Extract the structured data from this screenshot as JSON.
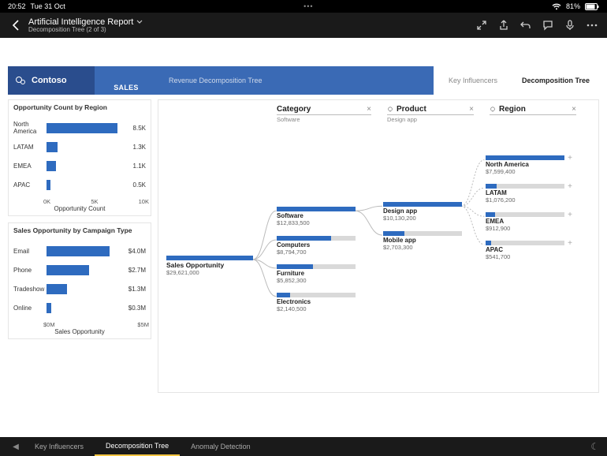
{
  "ios": {
    "time": "20:52",
    "date": "Tue 31 Oct",
    "battery": "81%"
  },
  "header": {
    "title": "Artificial Intelligence Report",
    "subtitle": "Decomposition Tree (2 of 3)"
  },
  "ribbon": {
    "brand": "Contoso",
    "sales": "SALES",
    "rev": "Revenue Decomposition Tree",
    "key": "Key Influencers",
    "decomp": "Decomposition Tree"
  },
  "mini_region": {
    "title": "Opportunity Count by Region",
    "axis_label": "Opportunity Count",
    "ticks": [
      "0K",
      "5K",
      "10K"
    ]
  },
  "mini_campaign": {
    "title": "Sales Opportunity by Campaign Type",
    "axis_label": "Sales Opportunity",
    "ticks": [
      "$0M",
      "$5M"
    ]
  },
  "tree_headers": {
    "category": {
      "title": "Category",
      "sub": "Software"
    },
    "product": {
      "title": "Product",
      "sub": "Design app"
    },
    "region": {
      "title": "Region",
      "sub": ""
    }
  },
  "tree": {
    "root": {
      "title": "Sales Opportunity",
      "value": "$29,621,000"
    },
    "software": {
      "title": "Software",
      "value": "$12,833,500"
    },
    "computers": {
      "title": "Computers",
      "value": "$8,794,700"
    },
    "furniture": {
      "title": "Furniture",
      "value": "$5,852,300"
    },
    "electronics": {
      "title": "Electronics",
      "value": "$2,140,500"
    },
    "design": {
      "title": "Design app",
      "value": "$10,130,200"
    },
    "mobile": {
      "title": "Mobile app",
      "value": "$2,703,300"
    },
    "na": {
      "title": "North America",
      "value": "$7,599,400"
    },
    "latam": {
      "title": "LATAM",
      "value": "$1,076,200"
    },
    "emea": {
      "title": "EMEA",
      "value": "$912,900"
    },
    "apac": {
      "title": "APAC",
      "value": "$541,700"
    }
  },
  "page_tabs": {
    "key": "Key Influencers",
    "decomp": "Decomposition Tree",
    "anomaly": "Anomaly Detection"
  },
  "chart_data": [
    {
      "type": "bar",
      "orientation": "horizontal",
      "title": "Opportunity Count by Region",
      "xlabel": "Opportunity Count",
      "xlim": [
        0,
        10
      ],
      "unit": "K",
      "categories": [
        "North America",
        "LATAM",
        "EMEA",
        "APAC"
      ],
      "values": [
        8.5,
        1.3,
        1.1,
        0.5
      ],
      "value_labels": [
        "8.5K",
        "1.3K",
        "1.1K",
        "0.5K"
      ]
    },
    {
      "type": "bar",
      "orientation": "horizontal",
      "title": "Sales Opportunity by Campaign Type",
      "xlabel": "Sales Opportunity",
      "xlim": [
        0,
        5
      ],
      "unit": "$M",
      "categories": [
        "Email",
        "Phone",
        "Tradeshow",
        "Online"
      ],
      "values": [
        4.0,
        2.7,
        1.3,
        0.3
      ],
      "value_labels": [
        "$4.0M",
        "$2.7M",
        "$1.3M",
        "$0.3M"
      ]
    },
    {
      "type": "tree",
      "title": "Decomposition Tree",
      "metric": "Sales Opportunity",
      "root": {
        "name": "Sales Opportunity",
        "value": 29621000
      },
      "levels": [
        {
          "name": "Category",
          "selected": "Software",
          "nodes": [
            {
              "name": "Software",
              "value": 12833500
            },
            {
              "name": "Computers",
              "value": 8794700
            },
            {
              "name": "Furniture",
              "value": 5852300
            },
            {
              "name": "Electronics",
              "value": 2140500
            }
          ]
        },
        {
          "name": "Product",
          "selected": "Design app",
          "parent": "Software",
          "nodes": [
            {
              "name": "Design app",
              "value": 10130200
            },
            {
              "name": "Mobile app",
              "value": 2703300
            }
          ]
        },
        {
          "name": "Region",
          "parent": "Design app",
          "nodes": [
            {
              "name": "North America",
              "value": 7599400
            },
            {
              "name": "LATAM",
              "value": 1076200
            },
            {
              "name": "EMEA",
              "value": 912900
            },
            {
              "name": "APAC",
              "value": 541700
            }
          ]
        }
      ]
    }
  ]
}
